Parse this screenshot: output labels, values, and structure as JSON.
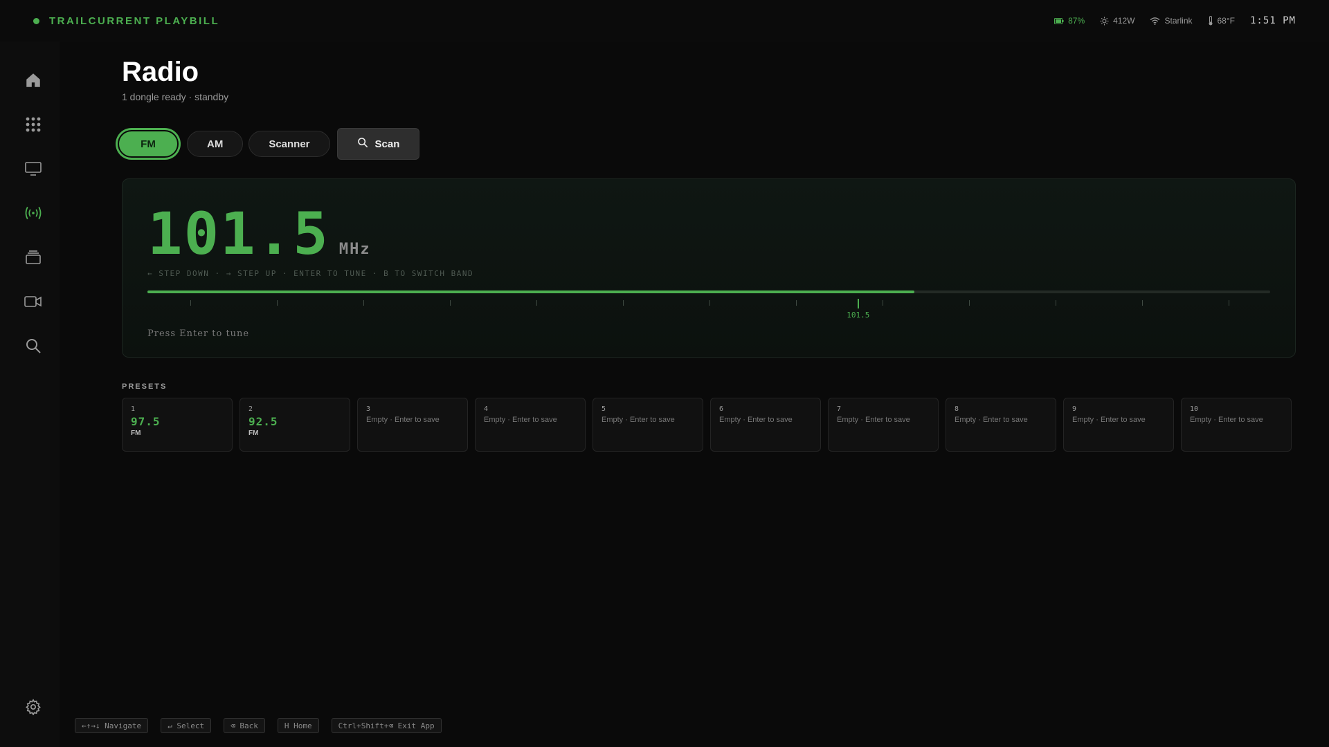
{
  "app": {
    "brand": "TRAILCURRENT PLAYBILL",
    "accent": "#4caf50"
  },
  "status": {
    "battery": "87%",
    "solar": "412W",
    "network": "Starlink",
    "temperature": "68°F",
    "clock": "1:51 PM"
  },
  "sidebar": {
    "items": [
      {
        "name": "home",
        "icon": "home-icon"
      },
      {
        "name": "apps",
        "icon": "grid-icon"
      },
      {
        "name": "tv",
        "icon": "monitor-icon"
      },
      {
        "name": "radio",
        "icon": "radio-waves-icon",
        "active": true
      },
      {
        "name": "library",
        "icon": "stack-icon"
      },
      {
        "name": "cameras",
        "icon": "video-camera-icon"
      },
      {
        "name": "search",
        "icon": "search-icon"
      },
      {
        "name": "settings",
        "icon": "gear-icon"
      }
    ]
  },
  "page": {
    "title": "Radio",
    "subtitle": "1 dongle ready · standby"
  },
  "bands": {
    "fm": "FM",
    "am": "AM",
    "scanner": "Scanner",
    "scan": "Scan",
    "selected": "FM"
  },
  "tuner": {
    "frequency": "101.5",
    "unit": "MHz",
    "hint": "← STEP DOWN · → STEP UP · ENTER TO TUNE · B TO SWITCH BAND",
    "position": 0.683,
    "needle_label": "101.5",
    "message": "Press Enter to tune"
  },
  "presets": {
    "label": "PRESETS",
    "items": [
      {
        "num": "1",
        "freq": "97.5",
        "band": "FM"
      },
      {
        "num": "2",
        "freq": "92.5",
        "band": "FM"
      },
      {
        "num": "3",
        "empty": "Empty · Enter to save"
      },
      {
        "num": "4",
        "empty": "Empty · Enter to save"
      },
      {
        "num": "5",
        "empty": "Empty · Enter to save"
      },
      {
        "num": "6",
        "empty": "Empty · Enter to save"
      },
      {
        "num": "7",
        "empty": "Empty · Enter to save"
      },
      {
        "num": "8",
        "empty": "Empty · Enter to save"
      },
      {
        "num": "9",
        "empty": "Empty · Enter to save"
      },
      {
        "num": "10",
        "empty": "Empty · Enter to save"
      }
    ]
  },
  "key_hints": {
    "navigate": "←↑→↓ Navigate",
    "select": "↵ Select",
    "back": "⌫ Back",
    "home": "H Home",
    "exit": "Ctrl+Shift+⌫ Exit App"
  }
}
